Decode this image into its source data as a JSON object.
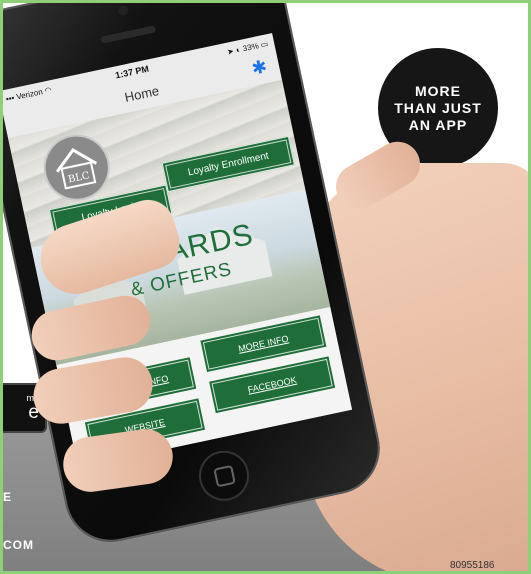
{
  "promo": {
    "headline_line1": "MORE",
    "headline_line2": "THAN JUST",
    "headline_line3": "AN APP",
    "badge_small": "me",
    "badge_large": "e",
    "left_text_1": "E",
    "left_text_2": "COM",
    "serial": "80955186"
  },
  "status_bar": {
    "carrier": "Verizon",
    "time": "1:37 PM",
    "battery": "33%"
  },
  "nav": {
    "title": "Home",
    "settings_icon": "gear-icon"
  },
  "header": {
    "logo_initials": "BLC"
  },
  "buttons": {
    "loyalty_login": "Loyalty Login",
    "loyalty_enrollment": "Loyalty Enrollment",
    "business_info": "BUSINESS INFO",
    "more_info": "MORE INFO",
    "website": "WEBSITE",
    "facebook": "FACEBOOK"
  },
  "banner": {
    "line1": "REWARDS",
    "line2": "& OFFERS"
  },
  "colors": {
    "brand_green": "#1f6e3a",
    "frame_border": "#8fcf7a",
    "accent_blue": "#1a73e8"
  }
}
